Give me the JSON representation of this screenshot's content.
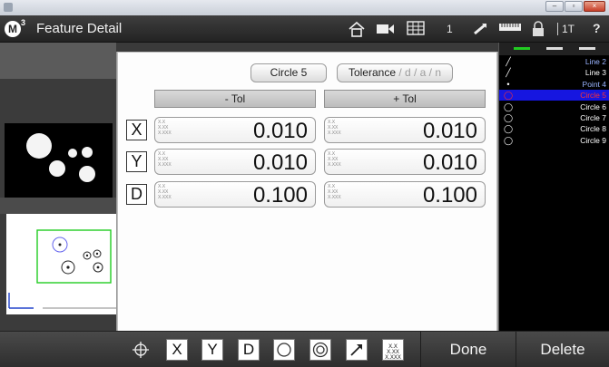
{
  "window": {
    "title": "Feature Detail",
    "logo_letter": "M",
    "logo_superscript": "3"
  },
  "titlebar": {
    "page_number": "1",
    "mode_label": "1T",
    "help_label": "?"
  },
  "dialog": {
    "feature_button": "Circle 5",
    "tolerance_button": {
      "label": "Tolerance",
      "options": " / d / a / n"
    },
    "minus_tol_header": "- Tol",
    "plus_tol_header": "+ Tol",
    "precision_hint": [
      "X.X",
      "X.XX",
      "X.XXX"
    ],
    "rows": [
      {
        "axis": "X",
        "minus": "0.010",
        "plus": "0.010"
      },
      {
        "axis": "Y",
        "minus": "0.010",
        "plus": "0.010"
      },
      {
        "axis": "D",
        "minus": "0.100",
        "plus": "0.100"
      }
    ]
  },
  "feature_list": [
    {
      "icon": "line-icon",
      "label": "Line 2",
      "style": "lblue"
    },
    {
      "icon": "line-icon",
      "label": "Line 3",
      "style": ""
    },
    {
      "icon": "point-icon",
      "label": "Point 4",
      "style": "lblue"
    },
    {
      "icon": "circle-icon",
      "label": "Circle 5",
      "style": "selected"
    },
    {
      "icon": "circle-icon",
      "label": "Circle 6",
      "style": ""
    },
    {
      "icon": "circle-icon",
      "label": "Circle 7",
      "style": ""
    },
    {
      "icon": "circle-icon",
      "label": "Circle 8",
      "style": ""
    },
    {
      "icon": "circle-icon",
      "label": "Circle 9",
      "style": ""
    }
  ],
  "bottombar": {
    "tools": [
      "X",
      "Y",
      "D"
    ],
    "precision_tool": [
      "X.X",
      "X.XX",
      "X.XXX"
    ],
    "done_label": "Done",
    "delete_label": "Delete"
  },
  "colors": {
    "selected_row": "#1616e0",
    "selected_text": "#ff3030",
    "part_outline": "#22cc22"
  }
}
